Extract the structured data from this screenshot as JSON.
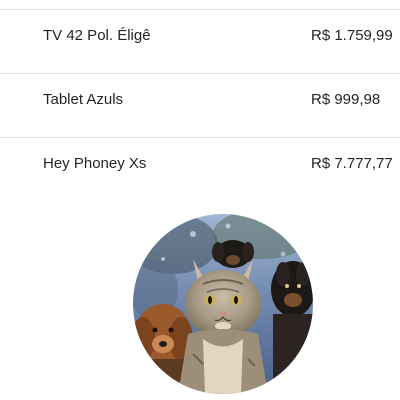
{
  "products": [
    {
      "name": "TV 42 Pol. Éligê",
      "price": "R$ 1.759,99"
    },
    {
      "name": "Tablet Azuls",
      "price": "R$ 999,98"
    },
    {
      "name": "Hey Phoney Xs",
      "price": "R$ 7.777,77"
    }
  ],
  "colors": {
    "text": "#212529",
    "divider": "#dee2e6",
    "background": "#ffffff"
  },
  "avatar": {
    "icon": "pets-photo-avatar"
  }
}
